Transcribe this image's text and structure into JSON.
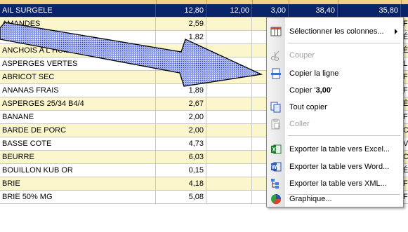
{
  "table": {
    "rows": [
      {
        "name": "AIL SURGELE",
        "p1": "12,80",
        "p2": "12,00",
        "p3": "3,00",
        "p4": "38,40",
        "p5": "35,80",
        "x": "",
        "selected": true
      },
      {
        "name": "AMANDES",
        "p1": "2,59",
        "p2": "",
        "p3": "",
        "p4": "",
        "p5": "",
        "x": "F"
      },
      {
        "name": "ANANAS",
        "p1": "1,82",
        "p2": "",
        "p3": "",
        "p4": "",
        "p5": "",
        "x": "É"
      },
      {
        "name": "ANCHOIS A L HUILE",
        "p1": "12,57",
        "p2": "",
        "p3": "",
        "p4": "",
        "p5": "",
        "x": "É"
      },
      {
        "name": "ASPERGES VERTES",
        "p1": "3,19",
        "p2": "",
        "p3": "",
        "p4": "",
        "p5": "",
        "x": "L"
      },
      {
        "name": "ABRICOT SEC",
        "p1": "5,46",
        "p2": "",
        "p3": "",
        "p4": "",
        "p5": "",
        "x": "F"
      },
      {
        "name": "ANANAS FRAIS",
        "p1": "1,89",
        "p2": "",
        "p3": "",
        "p4": "",
        "p5": "",
        "x": "F"
      },
      {
        "name": "ASPERGES 25/34  B4/4",
        "p1": "2,67",
        "p2": "",
        "p3": "",
        "p4": "",
        "p5": "",
        "x": "É"
      },
      {
        "name": "BANANE",
        "p1": "2,00",
        "p2": "",
        "p3": "",
        "p4": "",
        "p5": "",
        "x": "F"
      },
      {
        "name": "BARDE DE PORC",
        "p1": "2,00",
        "p2": "",
        "p3": "",
        "p4": "",
        "p5": "",
        "x": "C"
      },
      {
        "name": "BASSE COTE",
        "p1": "4,73",
        "p2": "",
        "p3": "",
        "p4": "",
        "p5": "",
        "x": "V"
      },
      {
        "name": "BEURRE",
        "p1": "6,03",
        "p2": "",
        "p3": "",
        "p4": "",
        "p5": "",
        "x": "C"
      },
      {
        "name": "BOUILLON KUB OR",
        "p1": "0,15",
        "p2": "",
        "p3": "",
        "p4": "",
        "p5": "",
        "x": "É"
      },
      {
        "name": "BRIE",
        "p1": "4,18",
        "p2": "",
        "p3": "",
        "p4": "",
        "p5": "",
        "x": "F"
      },
      {
        "name": "BRIE 50% MG",
        "p1": "5,08",
        "p2": "",
        "p3": "3,00",
        "p4": "15,24",
        "p5": "10,16",
        "x": "F"
      }
    ]
  },
  "context_menu": {
    "items": [
      {
        "id": "select-columns",
        "label": "Sélectionner les colonnes...",
        "icon": "columns-icon",
        "submenu": true,
        "enabled": true
      },
      {
        "id": "cut",
        "label": "Couper",
        "icon": "scissors-icon",
        "enabled": false
      },
      {
        "id": "copy-row",
        "label": "Copier la ligne",
        "icon": "copy-row-icon",
        "enabled": true
      },
      {
        "id": "copy-value",
        "label_prefix": "Copier '",
        "label_value": "3,00",
        "label_suffix": "'",
        "enabled": true
      },
      {
        "id": "copy-all",
        "label": "Tout copier",
        "icon": "copy-all-icon",
        "enabled": true
      },
      {
        "id": "paste",
        "label": "Coller",
        "icon": "paste-icon",
        "enabled": false
      },
      {
        "id": "export-excel",
        "label": "Exporter la table vers Excel...",
        "icon": "excel-icon",
        "enabled": true
      },
      {
        "id": "export-word",
        "label": "Exporter la table vers Word...",
        "icon": "word-icon",
        "enabled": true
      },
      {
        "id": "export-xml",
        "label": "Exporter la table vers XML...",
        "icon": "xml-icon",
        "enabled": true
      },
      {
        "id": "chart",
        "label": "Graphique...",
        "icon": "pie-chart-icon",
        "enabled": true
      }
    ]
  },
  "colors": {
    "selected_row": "#0a246a",
    "alt_row": "#fbf6cc",
    "header": "#f3cf87",
    "arrow_fill": "#7f93e3"
  }
}
